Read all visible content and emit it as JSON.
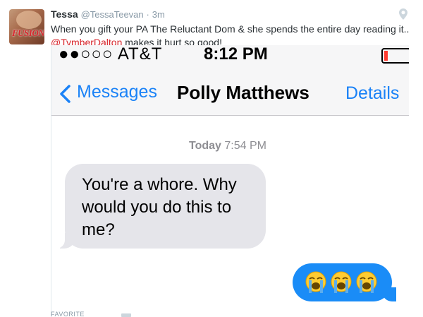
{
  "tweet": {
    "author_name": "Tessa",
    "author_handle": "@TessaTeevan",
    "separator": "·",
    "time": "3m",
    "text_before": "When you gift your PA The Reluctant Dom & she spends the entire day reading it.. ",
    "mention": "@TymberDalton",
    "text_after": " makes it hurt so good!",
    "avatar_text": "FUSION",
    "accent_color": "#d7262c"
  },
  "screenshot": {
    "status_bar": {
      "carrier": "●●○○○ AT&T",
      "time": "8:12 PM"
    },
    "nav": {
      "back_label": "Messages",
      "contact": "Polly Matthews",
      "details": "Details",
      "link_color": "#1a82f7"
    },
    "timestamp": {
      "day": "Today",
      "time": "7:54 PM"
    },
    "incoming_message": "You're a whore. Why would you do this to me?",
    "outgoing_emojis": [
      "loudly-crying-face",
      "loudly-crying-face",
      "loudly-crying-face"
    ],
    "outgoing_bubble_color": "#1a8cf7",
    "incoming_bubble_color": "#e5e5ea"
  },
  "footer": {
    "label": "FAVORITE"
  }
}
